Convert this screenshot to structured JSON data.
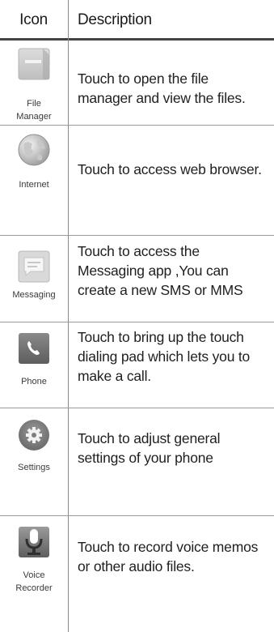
{
  "header": {
    "icon_label": "Icon",
    "description_label": "Description"
  },
  "rows": [
    {
      "icon": "file-manager-icon",
      "label_lines": [
        "File",
        "Manager"
      ],
      "desc_lines": [
        "Touch to open the file",
        "manager and view the files."
      ]
    },
    {
      "icon": "internet-globe-icon",
      "label_lines": [
        "Internet"
      ],
      "desc_lines": [
        "Touch to access web browser."
      ]
    },
    {
      "icon": "messaging-icon",
      "label_lines": [
        "Messaging"
      ],
      "desc_lines": [
        "Touch to access the",
        "Messaging app ,You can",
        "create a new SMS or MMS"
      ]
    },
    {
      "icon": "phone-icon",
      "label_lines": [
        "Phone"
      ],
      "desc_lines": [
        "Touch to bring up the touch",
        "dialing pad which lets you to",
        "make a call."
      ]
    },
    {
      "icon": "settings-gear-icon",
      "label_lines": [
        "Settings"
      ],
      "desc_lines": [
        "Touch to adjust general",
        "settings of your phone"
      ]
    },
    {
      "icon": "voice-recorder-microphone-icon",
      "label_lines": [
        "Voice",
        "Recorder"
      ],
      "desc_lines": [
        "Touch to record voice memos",
        "or other audio files."
      ]
    }
  ],
  "colors": {
    "header_rule": "#444444",
    "row_rule": "#9a9a9a",
    "text": "#1f1f1f"
  }
}
